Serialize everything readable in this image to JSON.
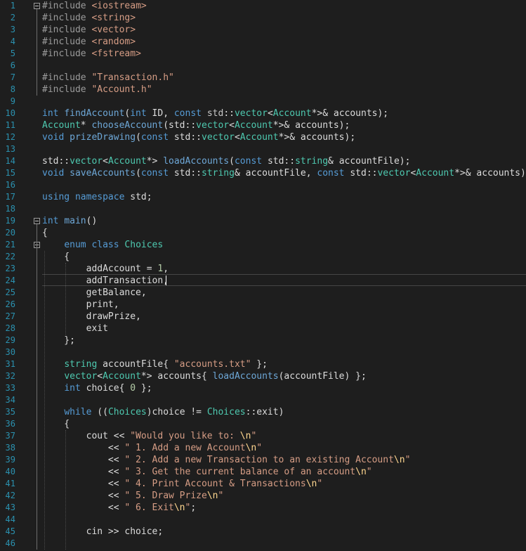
{
  "editor": {
    "line_numbers": [
      "1",
      "2",
      "3",
      "4",
      "5",
      "6",
      "7",
      "8",
      "9",
      "10",
      "11",
      "12",
      "13",
      "14",
      "15",
      "16",
      "17",
      "18",
      "19",
      "20",
      "21",
      "22",
      "23",
      "24",
      "25",
      "26",
      "27",
      "28",
      "29",
      "30",
      "31",
      "32",
      "33",
      "34",
      "35",
      "36",
      "37",
      "38",
      "39",
      "40",
      "41",
      "42",
      "43",
      "44",
      "45",
      "46"
    ],
    "lines": [
      [
        {
          "t": "#include ",
          "c": "pp"
        },
        {
          "t": "<iostream>",
          "c": "str"
        }
      ],
      [
        {
          "t": "#include ",
          "c": "pp"
        },
        {
          "t": "<string>",
          "c": "str"
        }
      ],
      [
        {
          "t": "#include ",
          "c": "pp"
        },
        {
          "t": "<vector>",
          "c": "str"
        }
      ],
      [
        {
          "t": "#include ",
          "c": "pp"
        },
        {
          "t": "<random>",
          "c": "str"
        }
      ],
      [
        {
          "t": "#include ",
          "c": "pp"
        },
        {
          "t": "<fstream>",
          "c": "str"
        }
      ],
      [],
      [
        {
          "t": "#include ",
          "c": "pp"
        },
        {
          "t": "\"Transaction.h\"",
          "c": "str"
        }
      ],
      [
        {
          "t": "#include ",
          "c": "pp"
        },
        {
          "t": "\"Account.h\"",
          "c": "str"
        }
      ],
      [],
      [
        {
          "t": "int ",
          "c": "kw"
        },
        {
          "t": "findAccount",
          "c": "fn"
        },
        {
          "t": "(",
          "c": "txt"
        },
        {
          "t": "int ",
          "c": "kw"
        },
        {
          "t": "ID, ",
          "c": "txt"
        },
        {
          "t": "const ",
          "c": "kw"
        },
        {
          "t": "std",
          "c": "ns"
        },
        {
          "t": "::",
          "c": "txt"
        },
        {
          "t": "vector",
          "c": "ty"
        },
        {
          "t": "<",
          "c": "txt"
        },
        {
          "t": "Account",
          "c": "ty"
        },
        {
          "t": "*>& accounts);",
          "c": "txt"
        }
      ],
      [
        {
          "t": "Account",
          "c": "ty"
        },
        {
          "t": "* ",
          "c": "txt"
        },
        {
          "t": "chooseAccount",
          "c": "fn"
        },
        {
          "t": "(std::",
          "c": "txt"
        },
        {
          "t": "vector",
          "c": "ty"
        },
        {
          "t": "<",
          "c": "txt"
        },
        {
          "t": "Account",
          "c": "ty"
        },
        {
          "t": "*>& accounts);",
          "c": "txt"
        }
      ],
      [
        {
          "t": "void ",
          "c": "kw"
        },
        {
          "t": "prizeDrawing",
          "c": "fn"
        },
        {
          "t": "(",
          "c": "txt"
        },
        {
          "t": "const ",
          "c": "kw"
        },
        {
          "t": "std::",
          "c": "txt"
        },
        {
          "t": "vector",
          "c": "ty"
        },
        {
          "t": "<",
          "c": "txt"
        },
        {
          "t": "Account",
          "c": "ty"
        },
        {
          "t": "*>& accounts);",
          "c": "txt"
        }
      ],
      [],
      [
        {
          "t": "std::",
          "c": "txt"
        },
        {
          "t": "vector",
          "c": "ty"
        },
        {
          "t": "<",
          "c": "txt"
        },
        {
          "t": "Account",
          "c": "ty"
        },
        {
          "t": "*> ",
          "c": "txt"
        },
        {
          "t": "loadAccounts",
          "c": "fn"
        },
        {
          "t": "(",
          "c": "txt"
        },
        {
          "t": "const ",
          "c": "kw"
        },
        {
          "t": "std::",
          "c": "txt"
        },
        {
          "t": "string",
          "c": "ty"
        },
        {
          "t": "& accountFile);",
          "c": "txt"
        }
      ],
      [
        {
          "t": "void ",
          "c": "kw"
        },
        {
          "t": "saveAccounts",
          "c": "fn"
        },
        {
          "t": "(",
          "c": "txt"
        },
        {
          "t": "const ",
          "c": "kw"
        },
        {
          "t": "std::",
          "c": "txt"
        },
        {
          "t": "string",
          "c": "ty"
        },
        {
          "t": "& accountFile, ",
          "c": "txt"
        },
        {
          "t": "const ",
          "c": "kw"
        },
        {
          "t": "std::",
          "c": "txt"
        },
        {
          "t": "vector",
          "c": "ty"
        },
        {
          "t": "<",
          "c": "txt"
        },
        {
          "t": "Account",
          "c": "ty"
        },
        {
          "t": "*>& accounts);",
          "c": "txt"
        }
      ],
      [],
      [
        {
          "t": "using ",
          "c": "kw"
        },
        {
          "t": "namespace ",
          "c": "kw"
        },
        {
          "t": "std;",
          "c": "txt"
        }
      ],
      [],
      [
        {
          "t": "int ",
          "c": "kw"
        },
        {
          "t": "main",
          "c": "fn"
        },
        {
          "t": "()",
          "c": "txt"
        }
      ],
      [
        {
          "t": "{",
          "c": "txt"
        }
      ],
      [
        {
          "t": "    ",
          "c": "txt"
        },
        {
          "t": "enum ",
          "c": "kw"
        },
        {
          "t": "class ",
          "c": "kw"
        },
        {
          "t": "Choices",
          "c": "ty"
        }
      ],
      [
        {
          "t": "    {",
          "c": "txt"
        }
      ],
      [
        {
          "t": "        addAccount = ",
          "c": "txt"
        },
        {
          "t": "1",
          "c": "num"
        },
        {
          "t": ",",
          "c": "txt"
        }
      ],
      [
        {
          "t": "        addTransaction,",
          "c": "txt"
        }
      ],
      [
        {
          "t": "        getBalance,",
          "c": "txt"
        }
      ],
      [
        {
          "t": "        print,",
          "c": "txt"
        }
      ],
      [
        {
          "t": "        drawPrize,",
          "c": "txt"
        }
      ],
      [
        {
          "t": "        exit",
          "c": "txt"
        }
      ],
      [
        {
          "t": "    };",
          "c": "txt"
        }
      ],
      [],
      [
        {
          "t": "    ",
          "c": "txt"
        },
        {
          "t": "string ",
          "c": "ty"
        },
        {
          "t": "accountFile{ ",
          "c": "txt"
        },
        {
          "t": "\"accounts.txt\"",
          "c": "str"
        },
        {
          "t": " };",
          "c": "txt"
        }
      ],
      [
        {
          "t": "    ",
          "c": "txt"
        },
        {
          "t": "vector",
          "c": "ty"
        },
        {
          "t": "<",
          "c": "txt"
        },
        {
          "t": "Account",
          "c": "ty"
        },
        {
          "t": "*> accounts{ ",
          "c": "txt"
        },
        {
          "t": "loadAccounts",
          "c": "fn"
        },
        {
          "t": "(accountFile) };",
          "c": "txt"
        }
      ],
      [
        {
          "t": "    ",
          "c": "txt"
        },
        {
          "t": "int ",
          "c": "kw"
        },
        {
          "t": "choice{ ",
          "c": "txt"
        },
        {
          "t": "0",
          "c": "num"
        },
        {
          "t": " };",
          "c": "txt"
        }
      ],
      [],
      [
        {
          "t": "    ",
          "c": "txt"
        },
        {
          "t": "while ",
          "c": "kw"
        },
        {
          "t": "((",
          "c": "txt"
        },
        {
          "t": "Choices",
          "c": "ty"
        },
        {
          "t": ")choice != ",
          "c": "txt"
        },
        {
          "t": "Choices",
          "c": "ty"
        },
        {
          "t": "::exit)",
          "c": "txt"
        }
      ],
      [
        {
          "t": "    {",
          "c": "txt"
        }
      ],
      [
        {
          "t": "        cout << ",
          "c": "txt"
        },
        {
          "t": "\"Would you like to: ",
          "c": "str"
        },
        {
          "t": "\\n",
          "c": "esc"
        },
        {
          "t": "\"",
          "c": "str"
        }
      ],
      [
        {
          "t": "            << ",
          "c": "txt"
        },
        {
          "t": "\" 1. Add a new Account",
          "c": "str"
        },
        {
          "t": "\\n",
          "c": "esc"
        },
        {
          "t": "\"",
          "c": "str"
        }
      ],
      [
        {
          "t": "            << ",
          "c": "txt"
        },
        {
          "t": "\" 2. Add a new Transaction to an existing Account",
          "c": "str"
        },
        {
          "t": "\\n",
          "c": "esc"
        },
        {
          "t": "\"",
          "c": "str"
        }
      ],
      [
        {
          "t": "            << ",
          "c": "txt"
        },
        {
          "t": "\" 3. Get the current balance of an account",
          "c": "str"
        },
        {
          "t": "\\n",
          "c": "esc"
        },
        {
          "t": "\"",
          "c": "str"
        }
      ],
      [
        {
          "t": "            << ",
          "c": "txt"
        },
        {
          "t": "\" 4. Print Account & Transactions",
          "c": "str"
        },
        {
          "t": "\\n",
          "c": "esc"
        },
        {
          "t": "\"",
          "c": "str"
        }
      ],
      [
        {
          "t": "            << ",
          "c": "txt"
        },
        {
          "t": "\" 5. Draw Prize",
          "c": "str"
        },
        {
          "t": "\\n",
          "c": "esc"
        },
        {
          "t": "\"",
          "c": "str"
        }
      ],
      [
        {
          "t": "            << ",
          "c": "txt"
        },
        {
          "t": "\" 6. Exit",
          "c": "str"
        },
        {
          "t": "\\n",
          "c": "esc"
        },
        {
          "t": "\"",
          "c": "str"
        },
        {
          "t": ";",
          "c": "txt"
        }
      ],
      [],
      [
        {
          "t": "        cin >> choice;",
          "c": "txt"
        }
      ],
      []
    ]
  }
}
